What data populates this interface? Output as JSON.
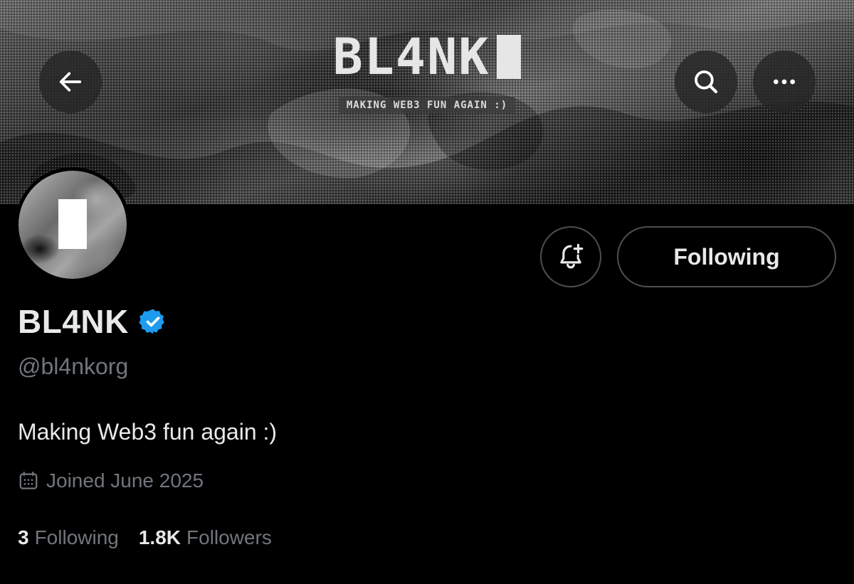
{
  "banner": {
    "logo_text": "BL4NK",
    "tagline": "MAKING WEB3 FUN AGAIN :)"
  },
  "nav": {
    "back_icon": "arrow-left-icon",
    "search_icon": "search-icon",
    "more_icon": "more-horizontal-icon"
  },
  "actions": {
    "notify_icon": "bell-plus-icon",
    "following_label": "Following"
  },
  "profile": {
    "display_name": "BL4NK",
    "verified": true,
    "verified_color": "#1d9bf0",
    "handle": "@bl4nkorg",
    "bio": "Making Web3 fun again :)",
    "joined_icon": "calendar-icon",
    "joined": "Joined June 2025",
    "following_count": "3",
    "following_label": "Following",
    "followers_count": "1.8K",
    "followers_label": "Followers"
  },
  "colors": {
    "text_primary": "#e7e9ea",
    "text_secondary": "#71767b",
    "border": "#4b4f54",
    "background": "#000000"
  }
}
